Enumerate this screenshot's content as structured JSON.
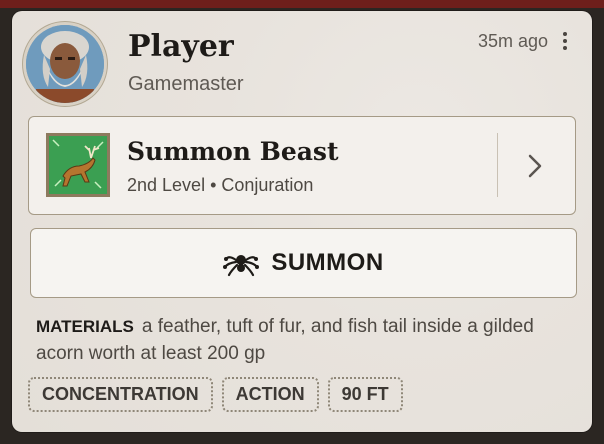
{
  "player": {
    "name": "Player",
    "role": "Gamemaster",
    "timestamp": "35m ago"
  },
  "spell": {
    "name": "Summon Beast",
    "meta": "2nd Level • Conjuration",
    "icon": "leaping-deer-icon"
  },
  "action": {
    "label": "SUMMON",
    "icon": "spider-summon-icon"
  },
  "materials": {
    "label": "MATERIALS",
    "text": "a feather, tuft of fur, and fish tail inside a gilded acorn worth at least 200 gp"
  },
  "tags": [
    "CONCENTRATION",
    "ACTION",
    "90 FT"
  ],
  "colors": {
    "card_bg": "#e8e3dd",
    "border": "#a59a86",
    "text_dark": "#1e1b18",
    "text_muted": "#5f5a54",
    "top_strip": "#6e1f1b"
  }
}
